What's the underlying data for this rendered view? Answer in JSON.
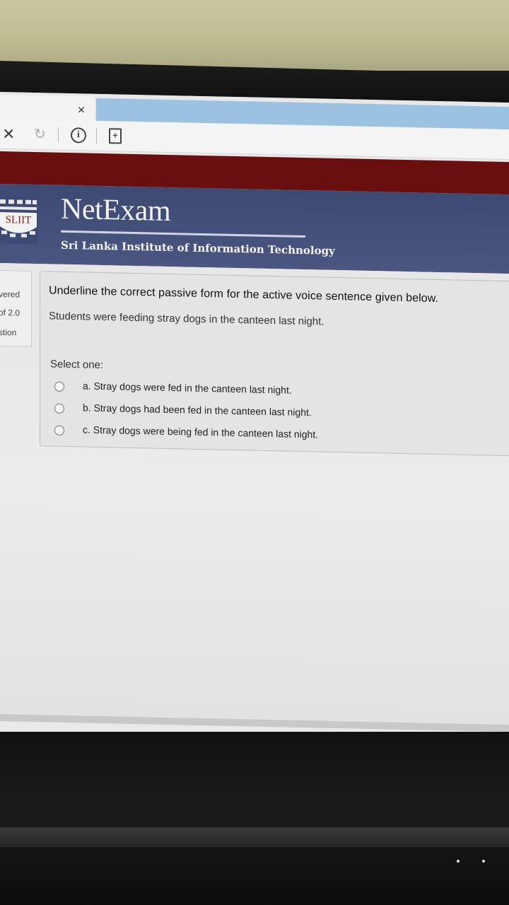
{
  "browser": {
    "tab_close_glyph": "×",
    "toolbar": {
      "stop_glyph": "×",
      "reload_glyph": "↻",
      "info_glyph": "i",
      "page_glyph": "+"
    }
  },
  "header": {
    "brand": "NetExam",
    "institute": "Sri Lanka Institute of Information Technology",
    "logo_text": "SLIIT",
    "colors": {
      "redbar": "#6a0f10",
      "bluebar": "#434f78",
      "accent_line": "#e2742a"
    }
  },
  "side_panel": {
    "lines": [
      "vered",
      "of 2.0",
      "stion"
    ]
  },
  "question": {
    "title": "Underline the correct passive form for the active voice sentence given below.",
    "sentence": "Students were feeding stray dogs in the canteen last night.",
    "select_label": "Select one:",
    "options": [
      {
        "label": "a. Stray dogs were fed in the canteen last night.",
        "selected": false
      },
      {
        "label": "b. Stray dogs had been fed in the canteen last night.",
        "selected": false
      },
      {
        "label": "c. Stray dogs were being fed in the canteen last night.",
        "selected": false
      }
    ]
  }
}
